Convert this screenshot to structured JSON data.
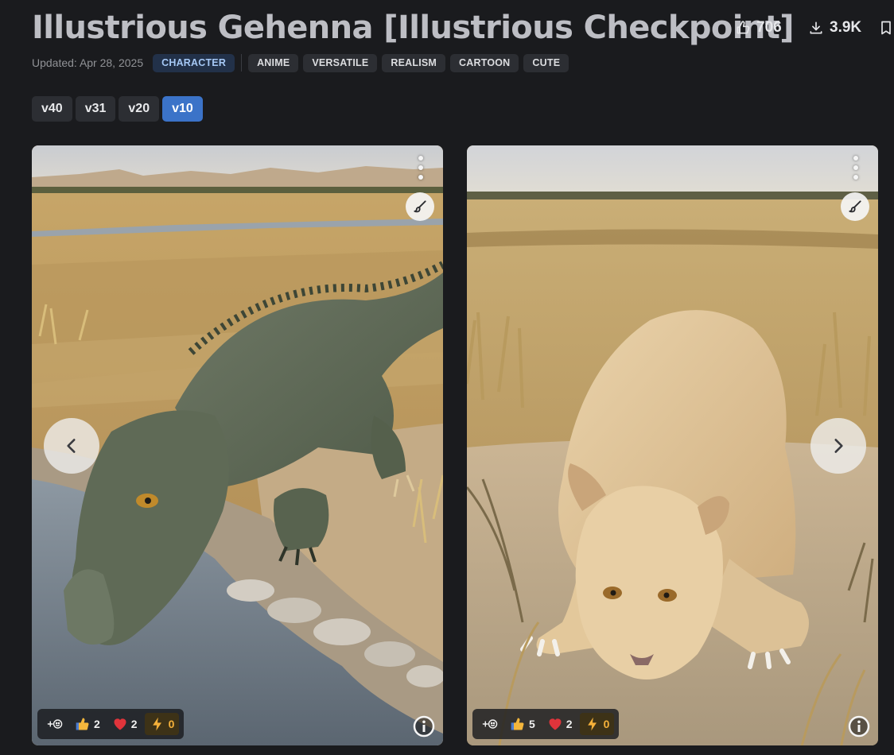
{
  "model": {
    "title": "Illustrious Gehenna [Illustrious Checkpoint]",
    "likes": "706",
    "downloads": "3.9K",
    "updated": "Updated: Apr 28, 2025"
  },
  "tags": {
    "primary": "CHARACTER",
    "list": [
      "ANIME",
      "VERSATILE",
      "REALISM",
      "CARTOON",
      "CUTE"
    ]
  },
  "versions": [
    "v40",
    "v31",
    "v20",
    "v10"
  ],
  "active_version": "v10",
  "gallery": {
    "cards": [
      {
        "subject": "crocodile drinking at a savanna waterhole",
        "reactions": {
          "like": "2",
          "heart": "2",
          "buzz": "0"
        }
      },
      {
        "subject": "lioness lying in dry savanna grass",
        "reactions": {
          "like": "5",
          "heart": "2",
          "buzz": "0"
        }
      }
    ]
  },
  "icons": {
    "likes": "thumb-up-icon",
    "downloads": "download-icon",
    "bookmark": "bookmark-icon",
    "menu": "kebab-menu-icon",
    "remix": "brush-icon",
    "add_reaction": "add-reaction-icon",
    "like": "thumbs-up-emoji-icon",
    "heart": "heart-emoji-icon",
    "buzz": "lightning-icon",
    "info": "info-icon",
    "prev": "chevron-left-icon",
    "next": "chevron-right-icon"
  },
  "colors": {
    "background": "#1a1b1e",
    "accent": "#3b73c8",
    "primary_tag_text": "#a5c8f5",
    "buzz": "#f5b13a"
  }
}
